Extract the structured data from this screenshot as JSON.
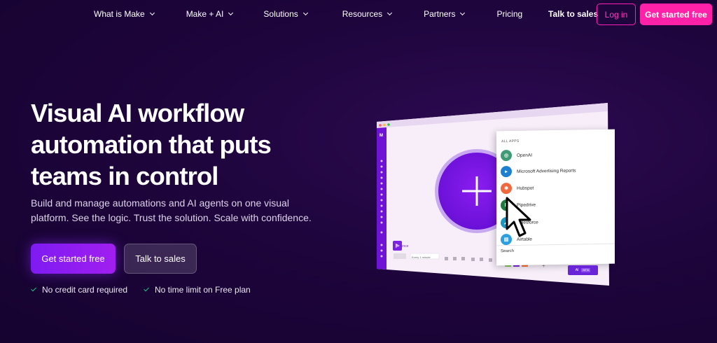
{
  "nav": {
    "items": [
      {
        "label": "What is Make",
        "dropdown": true
      },
      {
        "label": "Make + AI",
        "dropdown": true
      },
      {
        "label": "Solutions",
        "dropdown": true
      },
      {
        "label": "Resources",
        "dropdown": true
      },
      {
        "label": "Partners",
        "dropdown": true
      },
      {
        "label": "Pricing",
        "dropdown": false
      }
    ],
    "talk_to_sales": "Talk to sales",
    "login": "Log in",
    "get_started": "Get started free"
  },
  "hero": {
    "title": "Visual AI workflow automation that puts teams in control",
    "subtitle": "Build and manage automations and AI agents on one visual platform. See the logic. Trust the solution. Scale with confidence.",
    "cta_primary": "Get started free",
    "cta_secondary": "Talk to sales",
    "checks": [
      "No credit card required",
      "No time limit on Free plan"
    ]
  },
  "mockup": {
    "apps_header": "ALL APPS",
    "apps": [
      {
        "name": "OpenAI",
        "icon": "openai-icon",
        "color": "#3f9a76"
      },
      {
        "name": "Microsoft Advertising Reports",
        "icon": "microsoft-ads-icon",
        "color": "#1e7fd0"
      },
      {
        "name": "Hubspot",
        "icon": "hubspot-icon",
        "color": "#f1683f"
      },
      {
        "name": "Pipedrive",
        "icon": "pipedrive-icon",
        "color": "#1f7a3f"
      },
      {
        "name": "Salesforce",
        "icon": "salesforce-icon",
        "color": "#1798c1"
      },
      {
        "name": "Airtable",
        "icon": "airtable-icon",
        "color": "#2d9fe0"
      }
    ],
    "search_label": "Search",
    "run_once": "Run once",
    "schedule": "Every 1 minute",
    "ai_button": "AI",
    "ai_badge": "BETA",
    "colors": {
      "accent": "#7e1bf2",
      "brand_pink": "#ff21a8"
    }
  }
}
